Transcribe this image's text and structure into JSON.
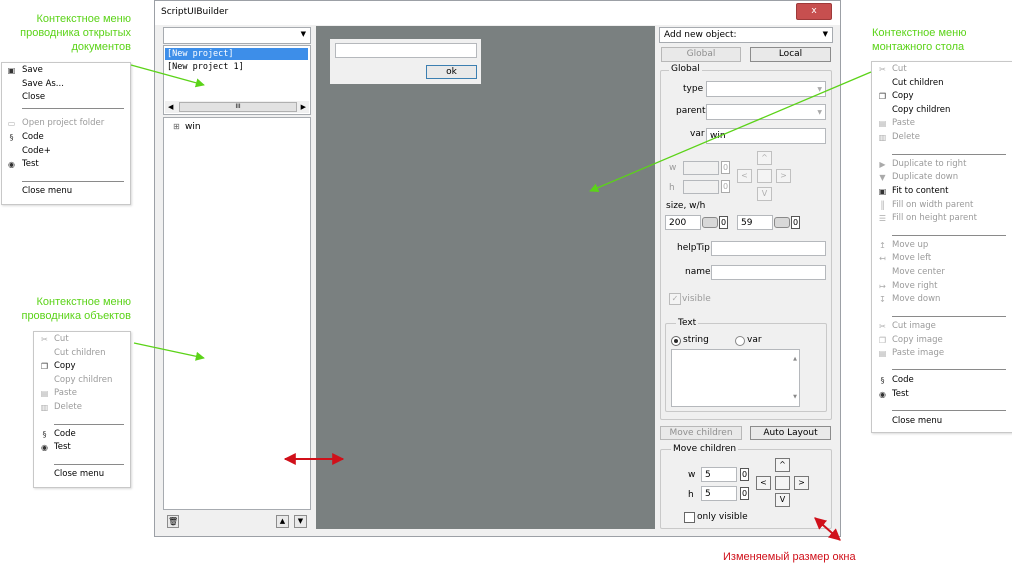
{
  "annotations": {
    "open_docs_menu": "Контекстное меню\nпроводника открытых\nдокументов",
    "objects_menu": "Контекстное меню\nпроводника объектов",
    "stage_menu": "Контекстное меню\nмонтажного стола",
    "resize": "Изменяемый размер окна"
  },
  "docs_menu": {
    "items": [
      {
        "label": "Save",
        "icon": "save-icon",
        "disabled": false
      },
      {
        "label": "Save As...",
        "icon": "",
        "disabled": false
      },
      {
        "label": "Close",
        "icon": "",
        "disabled": false
      },
      {
        "label": "Open project folder",
        "icon": "folder-icon",
        "disabled": true
      },
      {
        "label": "Code",
        "icon": "code-icon",
        "disabled": false
      },
      {
        "label": "Code+",
        "icon": "",
        "disabled": false
      },
      {
        "label": "Test",
        "icon": "eye-icon",
        "disabled": false
      },
      {
        "label": "Close menu",
        "icon": "",
        "disabled": false
      }
    ]
  },
  "objects_menu": {
    "items": [
      {
        "label": "Cut",
        "icon": "scissors-icon",
        "disabled": true
      },
      {
        "label": "Cut children",
        "icon": "",
        "disabled": true
      },
      {
        "label": "Copy",
        "icon": "copy-icon",
        "disabled": false
      },
      {
        "label": "Copy children",
        "icon": "",
        "disabled": true
      },
      {
        "label": "Paste",
        "icon": "paste-icon",
        "disabled": true
      },
      {
        "label": "Delete",
        "icon": "trash-icon",
        "disabled": true
      },
      {
        "label": "Code",
        "icon": "code-icon",
        "disabled": false
      },
      {
        "label": "Test",
        "icon": "eye-icon",
        "disabled": false
      },
      {
        "label": "Close menu",
        "icon": "",
        "disabled": false
      }
    ]
  },
  "stage_menu": {
    "items": [
      {
        "label": "Cut",
        "icon": "scissors-icon",
        "disabled": true
      },
      {
        "label": "Cut children",
        "icon": "",
        "disabled": false
      },
      {
        "label": "Copy",
        "icon": "copy-icon",
        "disabled": false
      },
      {
        "label": "Copy children",
        "icon": "",
        "disabled": false
      },
      {
        "label": "Paste",
        "icon": "paste-icon",
        "disabled": true
      },
      {
        "label": "Delete",
        "icon": "trash-icon",
        "disabled": true
      },
      {
        "label": "Duplicate to right",
        "icon": "triangle-right-icon",
        "disabled": true
      },
      {
        "label": "Duplicate down",
        "icon": "triangle-down-icon",
        "disabled": true
      },
      {
        "label": "Fit to content",
        "icon": "fit-icon",
        "disabled": false
      },
      {
        "label": "Fill on width parent",
        "icon": "fill-width-icon",
        "disabled": true
      },
      {
        "label": "Fill on height parent",
        "icon": "fill-height-icon",
        "disabled": true
      },
      {
        "label": "Move up",
        "icon": "move-up-icon",
        "disabled": true
      },
      {
        "label": "Move left",
        "icon": "move-left-icon",
        "disabled": true
      },
      {
        "label": "Move center",
        "icon": "",
        "disabled": true
      },
      {
        "label": "Move right",
        "icon": "move-right-icon",
        "disabled": true
      },
      {
        "label": "Move down",
        "icon": "move-down-icon",
        "disabled": true
      },
      {
        "label": "Cut image",
        "icon": "scissors-icon",
        "disabled": true
      },
      {
        "label": "Copy image",
        "icon": "copy-icon",
        "disabled": true
      },
      {
        "label": "Paste image",
        "icon": "paste-icon",
        "disabled": true
      },
      {
        "label": "Code",
        "icon": "code-icon",
        "disabled": false
      },
      {
        "label": "Test",
        "icon": "eye-icon",
        "disabled": false
      },
      {
        "label": "Close menu",
        "icon": "",
        "disabled": false
      }
    ]
  },
  "window": {
    "title": "ScriptUIBuilder",
    "close_glyph": "x",
    "docs": [
      "[New project]",
      "[New project 1]"
    ],
    "tree_root": "win",
    "tree_expander": "⊞",
    "scroll_thumb": "III",
    "preview_button": "ok",
    "add_object_label": "Add new object:",
    "global_button": "Global",
    "local_button": "Local",
    "global_group": "Global",
    "type_label": "type",
    "parent_label": "parent",
    "var_label": "var",
    "var_value": "win",
    "w_label": "w",
    "h_label": "h",
    "zero": "0",
    "size_label": "size, w/h",
    "size_w": "200",
    "size_h": "59",
    "helptip_label": "helpTip",
    "name_label": "name",
    "visible_label": "visible",
    "text_group": "Text",
    "string_label": "string",
    "var_radio_label": "var",
    "move_children_button": "Move children",
    "auto_layout_button": "Auto Layout",
    "move_group": "Move children",
    "move_w": "5",
    "move_h": "5",
    "only_visible_label": "only visible",
    "arrow_up": "^",
    "arrow_left": "<",
    "arrow_right": ">",
    "arrow_down": "V"
  }
}
